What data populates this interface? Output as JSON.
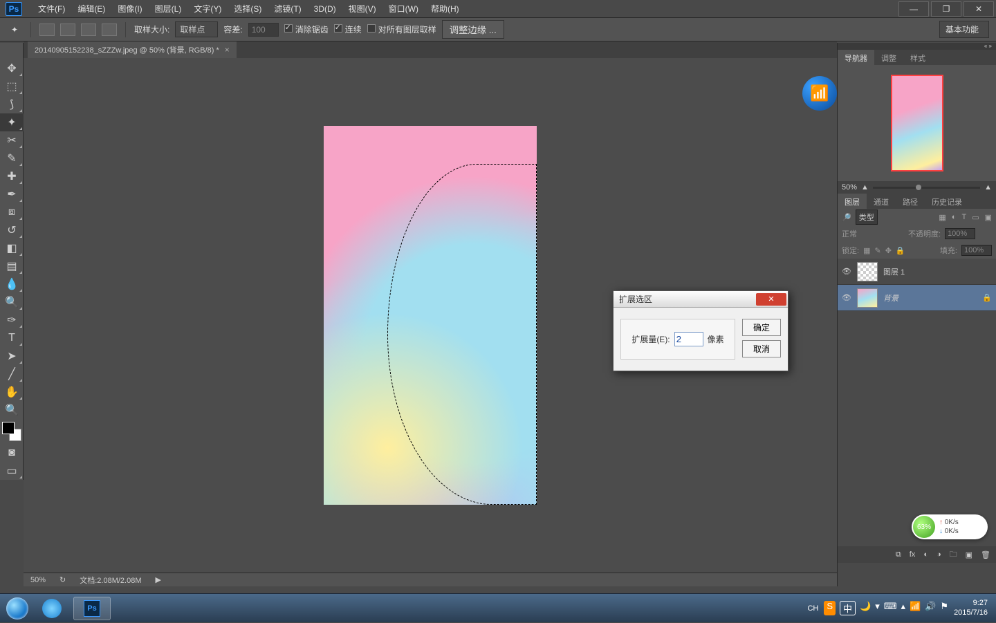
{
  "menubar": {
    "logo": "Ps",
    "items": [
      "文件(F)",
      "编辑(E)",
      "图像(I)",
      "图层(L)",
      "文字(Y)",
      "选择(S)",
      "滤镜(T)",
      "3D(D)",
      "视图(V)",
      "窗口(W)",
      "帮助(H)"
    ]
  },
  "optionsbar": {
    "sample_size_label": "取样大小:",
    "sample_size_value": "取样点",
    "tolerance_label": "容差:",
    "tolerance_value": "100",
    "antialias": "消除锯齿",
    "contiguous": "连续",
    "all_layers": "对所有图层取样",
    "refine_edge": "调整边缘 ...",
    "workspace": "基本功能"
  },
  "document": {
    "tab_title": "20140905152238_sZZZw.jpeg @ 50% (背景, RGB/8) *"
  },
  "statusbar": {
    "zoom": "50%",
    "docinfo": "文档:2.08M/2.08M"
  },
  "nav_panel": {
    "tabs": [
      "导航器",
      "调整",
      "样式"
    ],
    "zoom": "50%"
  },
  "layers_panel": {
    "tabs": [
      "图层",
      "通道",
      "路径",
      "历史记录"
    ],
    "type_filter": "类型",
    "blend_mode": "正常",
    "opacity_label": "不透明度:",
    "opacity_value": "100%",
    "lock_label": "锁定:",
    "fill_label": "填充:",
    "fill_value": "100%",
    "layers": [
      {
        "name": "图层 1",
        "locked": false,
        "thumb": "checker"
      },
      {
        "name": "背景",
        "locked": true,
        "thumb": "img",
        "italic": true
      }
    ]
  },
  "dialog": {
    "title": "扩展选区",
    "amount_label": "扩展量(E):",
    "amount_value": "2",
    "unit": "像素",
    "ok": "确定",
    "cancel": "取消"
  },
  "netspeed": {
    "pct": "63%",
    "up": "0K/s",
    "down": "0K/s"
  },
  "tray": {
    "ime": "CH",
    "sogou_label": "中",
    "time": "9:27",
    "date": "2015/7/16"
  }
}
